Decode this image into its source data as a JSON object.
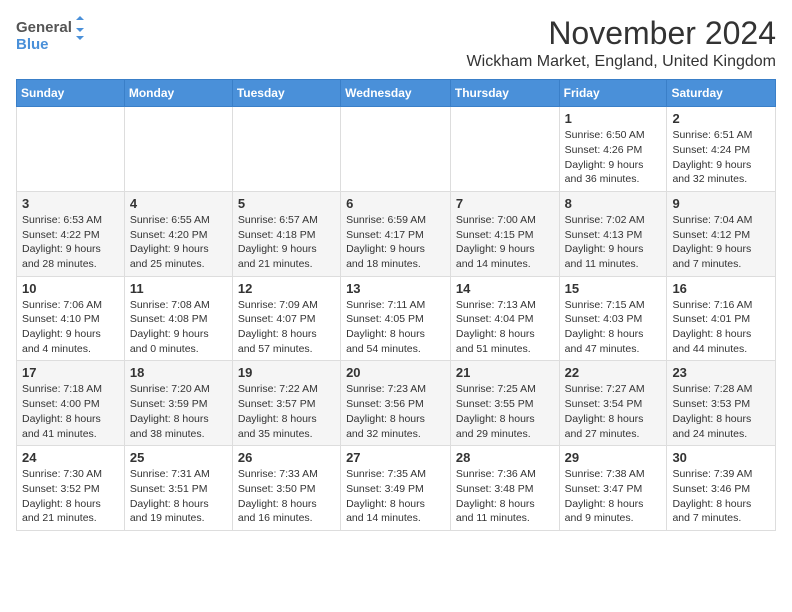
{
  "logo": {
    "general": "General",
    "blue": "Blue"
  },
  "title": "November 2024",
  "subtitle": "Wickham Market, England, United Kingdom",
  "days_of_week": [
    "Sunday",
    "Monday",
    "Tuesday",
    "Wednesday",
    "Thursday",
    "Friday",
    "Saturday"
  ],
  "weeks": [
    [
      {
        "day": "",
        "info": ""
      },
      {
        "day": "",
        "info": ""
      },
      {
        "day": "",
        "info": ""
      },
      {
        "day": "",
        "info": ""
      },
      {
        "day": "",
        "info": ""
      },
      {
        "day": "1",
        "info": "Sunrise: 6:50 AM\nSunset: 4:26 PM\nDaylight: 9 hours and 36 minutes."
      },
      {
        "day": "2",
        "info": "Sunrise: 6:51 AM\nSunset: 4:24 PM\nDaylight: 9 hours and 32 minutes."
      }
    ],
    [
      {
        "day": "3",
        "info": "Sunrise: 6:53 AM\nSunset: 4:22 PM\nDaylight: 9 hours and 28 minutes."
      },
      {
        "day": "4",
        "info": "Sunrise: 6:55 AM\nSunset: 4:20 PM\nDaylight: 9 hours and 25 minutes."
      },
      {
        "day": "5",
        "info": "Sunrise: 6:57 AM\nSunset: 4:18 PM\nDaylight: 9 hours and 21 minutes."
      },
      {
        "day": "6",
        "info": "Sunrise: 6:59 AM\nSunset: 4:17 PM\nDaylight: 9 hours and 18 minutes."
      },
      {
        "day": "7",
        "info": "Sunrise: 7:00 AM\nSunset: 4:15 PM\nDaylight: 9 hours and 14 minutes."
      },
      {
        "day": "8",
        "info": "Sunrise: 7:02 AM\nSunset: 4:13 PM\nDaylight: 9 hours and 11 minutes."
      },
      {
        "day": "9",
        "info": "Sunrise: 7:04 AM\nSunset: 4:12 PM\nDaylight: 9 hours and 7 minutes."
      }
    ],
    [
      {
        "day": "10",
        "info": "Sunrise: 7:06 AM\nSunset: 4:10 PM\nDaylight: 9 hours and 4 minutes."
      },
      {
        "day": "11",
        "info": "Sunrise: 7:08 AM\nSunset: 4:08 PM\nDaylight: 9 hours and 0 minutes."
      },
      {
        "day": "12",
        "info": "Sunrise: 7:09 AM\nSunset: 4:07 PM\nDaylight: 8 hours and 57 minutes."
      },
      {
        "day": "13",
        "info": "Sunrise: 7:11 AM\nSunset: 4:05 PM\nDaylight: 8 hours and 54 minutes."
      },
      {
        "day": "14",
        "info": "Sunrise: 7:13 AM\nSunset: 4:04 PM\nDaylight: 8 hours and 51 minutes."
      },
      {
        "day": "15",
        "info": "Sunrise: 7:15 AM\nSunset: 4:03 PM\nDaylight: 8 hours and 47 minutes."
      },
      {
        "day": "16",
        "info": "Sunrise: 7:16 AM\nSunset: 4:01 PM\nDaylight: 8 hours and 44 minutes."
      }
    ],
    [
      {
        "day": "17",
        "info": "Sunrise: 7:18 AM\nSunset: 4:00 PM\nDaylight: 8 hours and 41 minutes."
      },
      {
        "day": "18",
        "info": "Sunrise: 7:20 AM\nSunset: 3:59 PM\nDaylight: 8 hours and 38 minutes."
      },
      {
        "day": "19",
        "info": "Sunrise: 7:22 AM\nSunset: 3:57 PM\nDaylight: 8 hours and 35 minutes."
      },
      {
        "day": "20",
        "info": "Sunrise: 7:23 AM\nSunset: 3:56 PM\nDaylight: 8 hours and 32 minutes."
      },
      {
        "day": "21",
        "info": "Sunrise: 7:25 AM\nSunset: 3:55 PM\nDaylight: 8 hours and 29 minutes."
      },
      {
        "day": "22",
        "info": "Sunrise: 7:27 AM\nSunset: 3:54 PM\nDaylight: 8 hours and 27 minutes."
      },
      {
        "day": "23",
        "info": "Sunrise: 7:28 AM\nSunset: 3:53 PM\nDaylight: 8 hours and 24 minutes."
      }
    ],
    [
      {
        "day": "24",
        "info": "Sunrise: 7:30 AM\nSunset: 3:52 PM\nDaylight: 8 hours and 21 minutes."
      },
      {
        "day": "25",
        "info": "Sunrise: 7:31 AM\nSunset: 3:51 PM\nDaylight: 8 hours and 19 minutes."
      },
      {
        "day": "26",
        "info": "Sunrise: 7:33 AM\nSunset: 3:50 PM\nDaylight: 8 hours and 16 minutes."
      },
      {
        "day": "27",
        "info": "Sunrise: 7:35 AM\nSunset: 3:49 PM\nDaylight: 8 hours and 14 minutes."
      },
      {
        "day": "28",
        "info": "Sunrise: 7:36 AM\nSunset: 3:48 PM\nDaylight: 8 hours and 11 minutes."
      },
      {
        "day": "29",
        "info": "Sunrise: 7:38 AM\nSunset: 3:47 PM\nDaylight: 8 hours and 9 minutes."
      },
      {
        "day": "30",
        "info": "Sunrise: 7:39 AM\nSunset: 3:46 PM\nDaylight: 8 hours and 7 minutes."
      }
    ]
  ]
}
